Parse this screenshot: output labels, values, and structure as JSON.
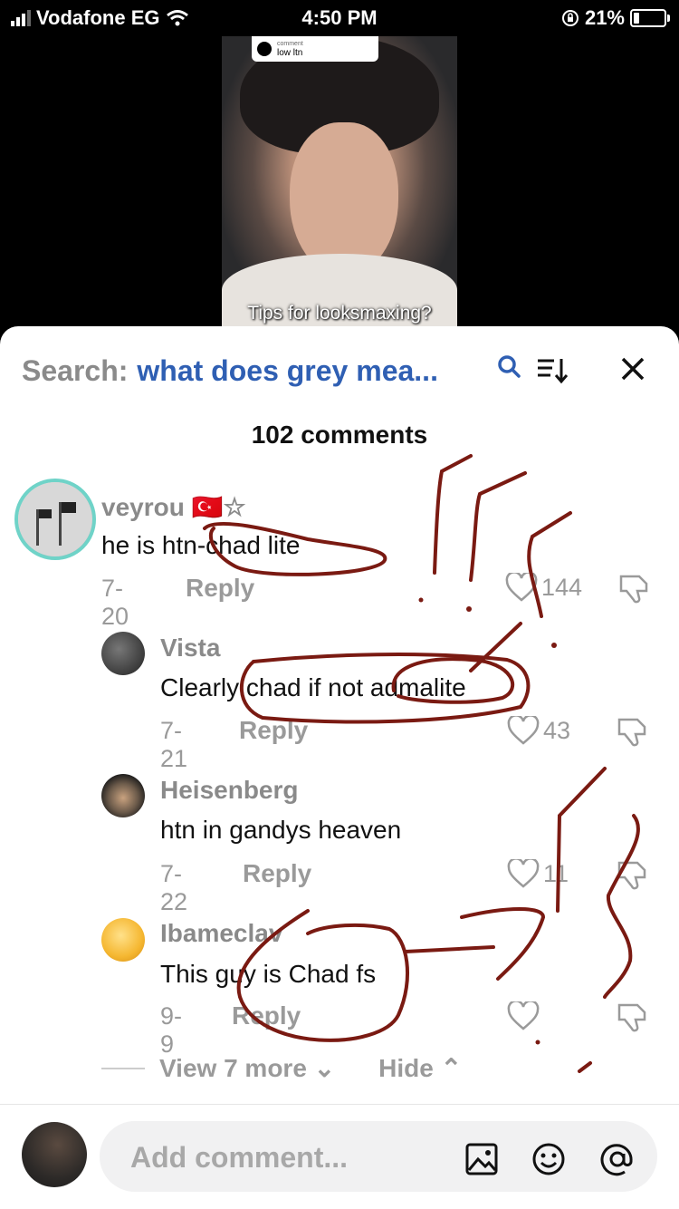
{
  "status_bar": {
    "carrier": "Vodafone EG",
    "time": "4:50 PM",
    "battery": "21%"
  },
  "video": {
    "chip_label": "comment",
    "chip_text": "low ltn",
    "caption": "Tips for looksmaxing?"
  },
  "search": {
    "label": "Search:",
    "query": "what does grey mea..."
  },
  "comments_count": "102 comments",
  "comments": [
    {
      "user": "veyrou",
      "flag": "🇹🇷☆",
      "text": "he is htn-chad lite",
      "date": "7-20",
      "reply": "Reply",
      "likes": "144"
    },
    {
      "user": "Vista",
      "text": "Clearly chad if not admalite",
      "date": "7-21",
      "reply": "Reply",
      "likes": "43"
    },
    {
      "user": "Heisenberg",
      "text": "htn in gandys heaven",
      "date": "7-22",
      "reply": "Reply",
      "likes": "11"
    },
    {
      "user": "Ibameclav",
      "text": "This guy is Chad fs",
      "date": "9-9",
      "reply": "Reply",
      "likes": ""
    }
  ],
  "view_more": "View 7 more",
  "hide": "Hide",
  "composer": {
    "placeholder": "Add comment..."
  },
  "colors": {
    "accent": "#2f5fb3",
    "annotation": "#7a1a12"
  }
}
